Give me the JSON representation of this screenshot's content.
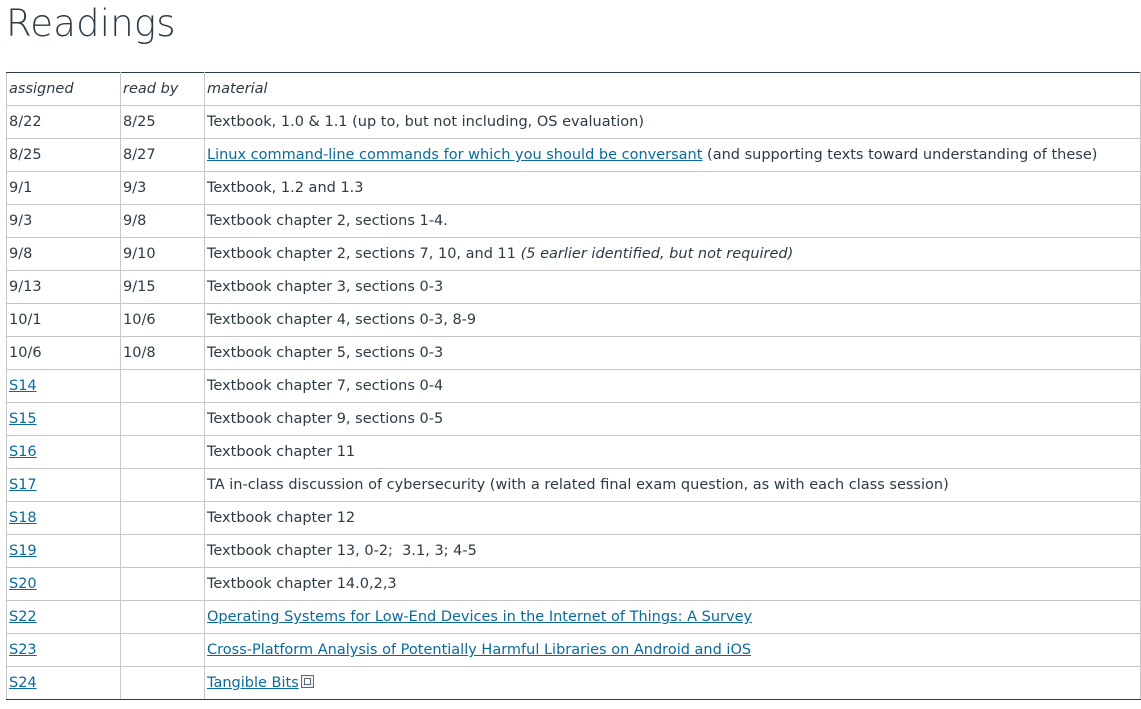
{
  "page": {
    "title": "Readings"
  },
  "table": {
    "headers": [
      "assigned",
      "read by",
      "material"
    ],
    "rows": [
      {
        "assigned": "8/22",
        "read_by": "8/25",
        "material": "Textbook, 1.0 & 1.1 (up to, but not including, OS evaluation)"
      },
      {
        "assigned": "8/25",
        "read_by": "8/27",
        "material_link": "Linux command-line commands for which you should be conversant",
        "material_rest": " (and supporting texts toward understanding of these)"
      },
      {
        "assigned": "9/1",
        "read_by": "9/3",
        "material": "Textbook, 1.2 and 1.3"
      },
      {
        "assigned": "9/3",
        "read_by": "9/8",
        "material": "Textbook chapter 2, sections 1-4."
      },
      {
        "assigned": "9/8",
        "read_by": "9/10",
        "material": "Textbook chapter 2, sections 7, 10, and 11 ",
        "material_note": "(5 earlier identified, but not required)"
      },
      {
        "assigned": "9/13",
        "read_by": "9/15",
        "material": "Textbook chapter 3, sections 0-3"
      },
      {
        "assigned": "10/1",
        "read_by": "10/6",
        "material": "Textbook chapter 4, sections 0-3, 8-9"
      },
      {
        "assigned": "10/6",
        "read_by": "10/8",
        "material": "Textbook chapter 5, sections 0-3"
      },
      {
        "assigned": "S14",
        "read_by": "",
        "material": "Textbook chapter 7, sections 0-4"
      },
      {
        "assigned": "S15",
        "read_by": "",
        "material": "Textbook chapter 9, sections 0-5"
      },
      {
        "assigned": "S16",
        "read_by": "",
        "material": "Textbook chapter 11"
      },
      {
        "assigned": "S17",
        "read_by": "",
        "material": "TA in-class discussion of cybersecurity (with a related final exam question, as with each class session)"
      },
      {
        "assigned": "S18",
        "read_by": "",
        "material": "Textbook chapter 12"
      },
      {
        "assigned": "S19",
        "read_by": "",
        "material": "Textbook chapter 13, 0-2;  3.1, 3; 4-5"
      },
      {
        "assigned": "S20",
        "read_by": "",
        "material": "Textbook chapter 14.0,2,3"
      },
      {
        "assigned": "S22",
        "read_by": "",
        "material_link": "Operating Systems for Low-End Devices in the Internet of Things: A Survey"
      },
      {
        "assigned": "S23",
        "read_by": "",
        "material_link": "Cross-Platform Analysis of Potentially Harmful Libraries on Android and iOS"
      },
      {
        "assigned": "S24",
        "read_by": "",
        "material_link": "Tangible Bits",
        "icon": "external-file-icon"
      }
    ]
  },
  "colors": {
    "text": "#2d3b45",
    "link": "#0b6a9b",
    "border": "#c7c7c7"
  }
}
